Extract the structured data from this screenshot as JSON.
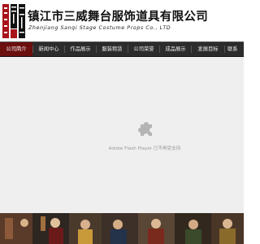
{
  "header": {
    "logo_name": "logo",
    "title": "镇江市三威舞台服饰道具有限公司",
    "subtitle": "Zhenjiang Sanqi Stage Costume Props Co., LTD"
  },
  "nav": {
    "items": [
      {
        "label": "公司简介",
        "active": true
      },
      {
        "label": "新闻中心"
      },
      {
        "label": "作品展示"
      },
      {
        "label": "服装租赁"
      },
      {
        "label": "公司荣誉"
      },
      {
        "label": "成品展示"
      },
      {
        "label": "发展目标"
      },
      {
        "label": "联系"
      }
    ]
  },
  "flash": {
    "icon": "puzzle-plugin-icon",
    "message": "Adobe Flash Player 已不再受支持"
  },
  "colors": {
    "nav_bg": "#2c2c2c",
    "nav_active": "#6b0f0f",
    "flash_bg": "#efefef",
    "logo_red": "#a8141a"
  }
}
